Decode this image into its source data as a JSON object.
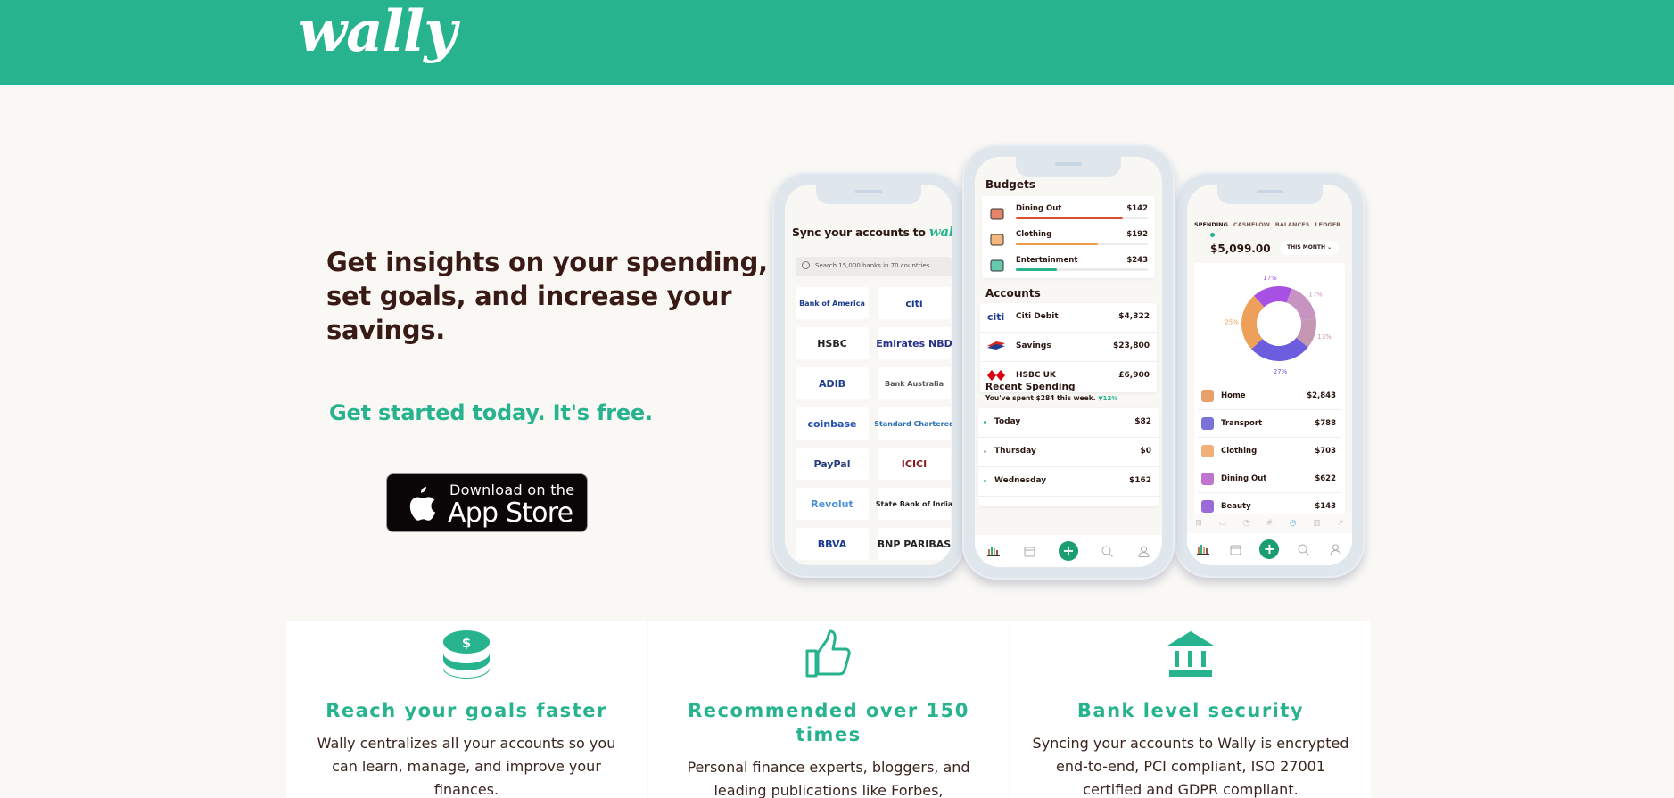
{
  "header": {
    "logo_text": "wally",
    "brand_color": "#26b38d"
  },
  "hero": {
    "title": "Get insights on your spending, set goals, and increase your savings.",
    "subtitle": "Get started today. It's free.",
    "appstore": {
      "line1": "Download on the",
      "line2": "App Store",
      "icon": "apple-icon"
    }
  },
  "phone_left": {
    "title_prefix": "Sync your accounts to",
    "title_logo": "wally",
    "search_placeholder": "Search 15,000 banks in 70 countries",
    "banks": [
      {
        "name": "Bank of America",
        "color": "#1f3d8f"
      },
      {
        "name": "citi",
        "color": "#1d3c8e"
      },
      {
        "name": "HSBC",
        "color": "#222"
      },
      {
        "name": "Emirates NBD",
        "color": "#27318b"
      },
      {
        "name": "ADIB",
        "color": "#1d3c8e"
      },
      {
        "name": "Bank Australia",
        "color": "#555"
      },
      {
        "name": "coinbase",
        "color": "#2050b0"
      },
      {
        "name": "Standard Chartered",
        "color": "#2a6fb5"
      },
      {
        "name": "PayPal",
        "color": "#253b80"
      },
      {
        "name": "ICICI",
        "color": "#8b1a1a"
      },
      {
        "name": "Revolut",
        "color": "#4a8fd8"
      },
      {
        "name": "State Bank of India",
        "color": "#222"
      },
      {
        "name": "BBVA",
        "color": "#1a3a8f"
      },
      {
        "name": "BNP PARIBAS",
        "color": "#222"
      }
    ]
  },
  "phone_mid": {
    "budgets_title": "Budgets",
    "budgets": [
      {
        "name": "Dining Out",
        "amount": "$142",
        "progress": 0.81,
        "color": "#d9502a",
        "icon": "takeout-box-icon"
      },
      {
        "name": "Clothing",
        "amount": "$192",
        "progress": 0.62,
        "color": "#ef9a49",
        "icon": "tshirt-icon"
      },
      {
        "name": "Entertainment",
        "amount": "$243",
        "progress": 0.31,
        "color": "#26b38d",
        "icon": "ticket-icon"
      }
    ],
    "accounts_title": "Accounts",
    "accounts": [
      {
        "name": "Citi Debit",
        "amount": "$4,322",
        "logo": "citi"
      },
      {
        "name": "Savings",
        "amount": "$23,800",
        "logo": "boa"
      },
      {
        "name": "HSBC UK",
        "amount": "£6,900",
        "logo": "hsbc"
      }
    ],
    "recent_title": "Recent Spending",
    "recent_note": "You've spent $284 this week.",
    "recent_change": "▼12%",
    "days": [
      {
        "name": "Today",
        "amount": "$82",
        "dot": "#26b38d"
      },
      {
        "name": "Thursday",
        "amount": "$0",
        "dot": "#b9a4c0"
      },
      {
        "name": "Wednesday",
        "amount": "$162",
        "dot": "#26b38d"
      }
    ]
  },
  "phone_right": {
    "tabs": [
      "SPENDING",
      "CASHFLOW",
      "BALANCES",
      "LEDGER"
    ],
    "active_tab": "SPENDING",
    "total": "$5,099.00",
    "period": "THIS MONTH",
    "donut": [
      {
        "label": "17%",
        "value": 17,
        "color": "#c793c0"
      },
      {
        "label": "13%",
        "value": 13,
        "color": "#c497b2"
      },
      {
        "label": "27%",
        "value": 27,
        "color": "#6c5ddf"
      },
      {
        "label": "25%",
        "value": 25,
        "color": "#eda059"
      },
      {
        "label": "17%",
        "value": 17,
        "color": "#a651e3"
      }
    ],
    "categories": [
      {
        "name": "Home",
        "amount": "$2,843",
        "color": "#e7a06a"
      },
      {
        "name": "Transport",
        "amount": "$788",
        "color": "#7a72d8"
      },
      {
        "name": "Clothing",
        "amount": "$703",
        "color": "#f1b07a"
      },
      {
        "name": "Dining Out",
        "amount": "$622",
        "color": "#c074d0"
      },
      {
        "name": "Beauty",
        "amount": "$143",
        "color": "#9a6ad8"
      }
    ],
    "subtabs": [
      "⊞",
      "▭",
      "◔",
      "#",
      "◷",
      "▥",
      "↗"
    ]
  },
  "tabbar": {
    "icons": [
      "bar-chart-icon",
      "calendar-icon",
      "add-icon",
      "search-icon",
      "user-icon"
    ],
    "plus": "+"
  },
  "features": [
    {
      "icon": "coins-icon",
      "title": "Reach your goals faster",
      "text": "Wally centralizes all your accounts so you can learn, manage, and improve your finances."
    },
    {
      "icon": "thumbs-up-icon",
      "title": "Recommended over 150 times",
      "text": "Personal finance experts, bloggers, and leading publications like Forbes,"
    },
    {
      "icon": "bank-icon",
      "title": "Bank level security",
      "text": "Syncing your accounts to Wally is encrypted end-to-end, PCI compliant, ISO 27001 certified and GDPR compliant."
    }
  ]
}
